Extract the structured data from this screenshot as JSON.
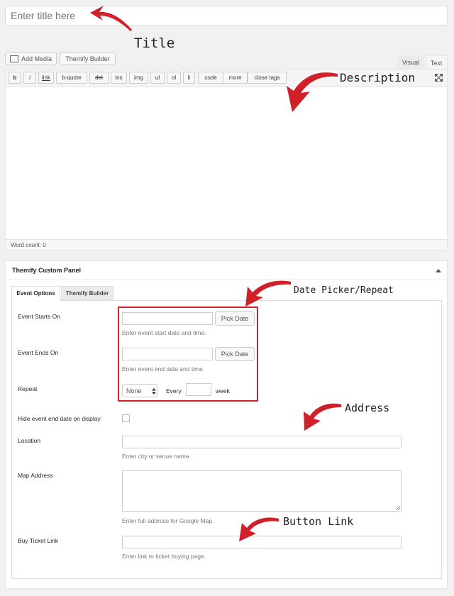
{
  "editor": {
    "title_placeholder": "Enter title here",
    "add_media_label": "Add Media",
    "themify_builder_label": "Themify Builder",
    "visual_tab": "Visual",
    "text_tab": "Text",
    "quicktags": [
      "b",
      "i",
      "link",
      "b-quote",
      "del",
      "ins",
      "img",
      "ul",
      "ol",
      "li",
      "code",
      "more",
      "close tags"
    ],
    "word_count": "Word count: 0"
  },
  "panel": {
    "title": "Themify Custom Panel",
    "tabs": [
      "Event Options",
      "Themify Builder"
    ],
    "event_starts_label": "Event Starts On",
    "pick_date_label": "Pick Date",
    "event_starts_desc": "Enter event start date and time.",
    "event_ends_label": "Event Ends On",
    "event_ends_desc": "Enter event end date and time.",
    "repeat_label": "Repeat",
    "repeat_value": "None",
    "every_label": "Every",
    "week_label": "week",
    "hide_end_label": "Hide event end date on display",
    "location_label": "Location",
    "location_desc": "Enter city or venue name.",
    "map_address_label": "Map Address",
    "map_address_desc": "Enter full address for Google Map.",
    "buy_ticket_label": "Buy Ticket Link",
    "buy_ticket_desc": "Enter link to ticket buying page."
  },
  "annotations": {
    "title": "Title",
    "description": "Description",
    "date_picker": "Date Picker/Repeat",
    "address": "Address",
    "button_link": "Button Link"
  },
  "colors": {
    "annotation_red": "#d0202a"
  }
}
